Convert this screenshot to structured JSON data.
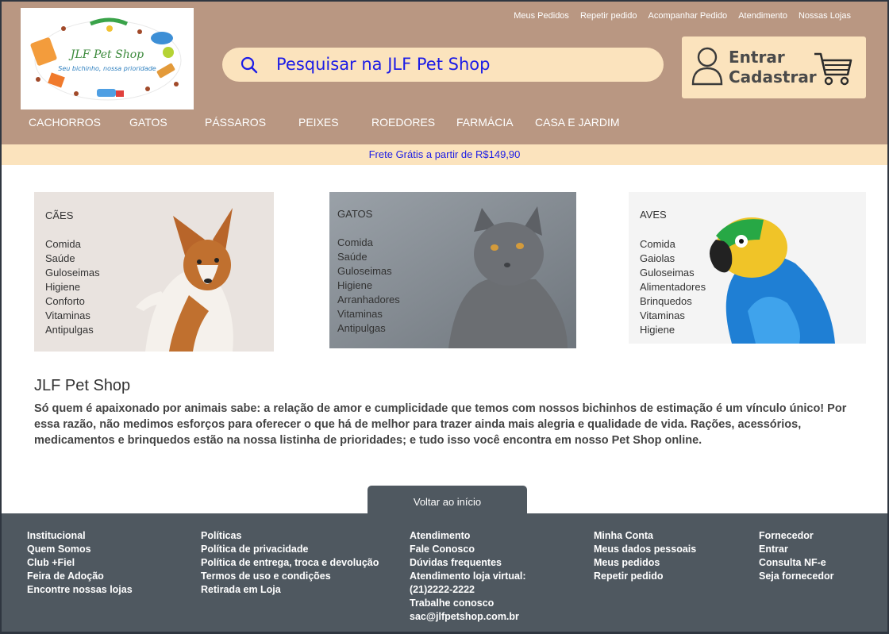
{
  "logo": {
    "title": "JLF Pet Shop",
    "subtitle": "Seu bichinho, nossa prioridade"
  },
  "top_links": [
    "Meus Pedidos",
    "Repetir pedido",
    "Acompanhar Pedido",
    "Atendimento",
    "Nossas Lojas"
  ],
  "search": {
    "placeholder": "Pesquisar na JLF Pet Shop"
  },
  "account": {
    "line1": "Entrar",
    "line2": "Cadastrar"
  },
  "nav": [
    "CACHORROS",
    "GATOS",
    "PÁSSAROS",
    "PEIXES",
    "ROEDORES",
    "FARMÁCIA",
    "CASA E JARDIM"
  ],
  "banner": "Frete Grátis a partir de R$149,90",
  "cards": {
    "dogs": {
      "title": "CÃES",
      "items": [
        "Comida",
        "Saúde",
        "Guloseimas",
        "Higiene",
        "Conforto",
        "Vitaminas",
        "Antipulgas"
      ]
    },
    "cats": {
      "title": "GATOS",
      "items": [
        "Comida",
        "Saúde",
        "Guloseimas",
        "Higiene",
        "Arranhadores",
        "Vitaminas",
        "Antipulgas"
      ]
    },
    "birds": {
      "title": "AVES",
      "items": [
        "Comida",
        "Gaiolas",
        "Guloseimas",
        "Alimentadores",
        "Brinquedos",
        "Vitaminas",
        "Higiene"
      ]
    }
  },
  "about": {
    "title": "JLF Pet Shop",
    "text": "Só quem é apaixonado por animais sabe: a relação de amor e cumplicidade que temos com nossos bichinhos de estimação é um vínculo único! Por essa razão, não medimos esforços para oferecer o que há de melhor para trazer ainda mais alegria e qualidade de vida. Rações, acessórios, medicamentos e brinquedos estão na nossa listinha de prioridades; e tudo isso você encontra em nosso Pet Shop online."
  },
  "back_to_top": "Voltar ao início",
  "footer": {
    "col1": [
      "Institucional",
      "Quem Somos",
      "Club +Fiel",
      "Feira de Adoção",
      "Encontre nossas lojas"
    ],
    "col2": [
      "Políticas",
      "Política de privacidade",
      "Política de entrega, troca e devolução",
      "Termos de uso e condições",
      "Retirada em Loja"
    ],
    "col3": [
      "Atendimento",
      "Fale Conosco",
      "Dúvidas frequentes",
      "Atendimento loja virtual:",
      "(21)2222-2222",
      "Trabalhe conosco",
      "sac@jlfpetshop.com.br"
    ],
    "col4": [
      "Minha Conta",
      "Meus dados pessoais",
      "Meus pedidos",
      "Repetir pedido"
    ],
    "col5": [
      "Fornecedor",
      "Entrar",
      "Consulta NF-e",
      "Seja fornecedor"
    ]
  },
  "colors": {
    "header_bg": "#b99782",
    "accent_cream": "#fbe3bd",
    "link_blue": "#1c1ce6",
    "footer_bg": "#4f5860"
  }
}
